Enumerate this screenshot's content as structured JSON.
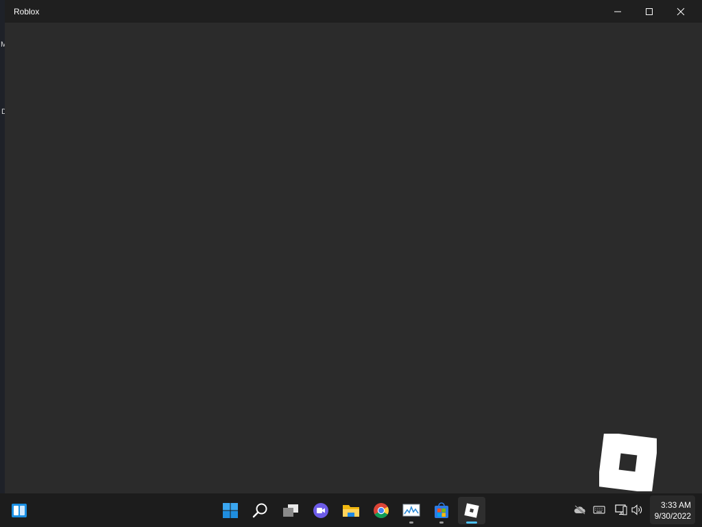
{
  "window": {
    "title": "Roblox",
    "controls": [
      "minimize-icon",
      "maximize-icon",
      "close-icon"
    ]
  },
  "desktop": {
    "fragment_1": "M",
    "fragment_2": "D"
  },
  "taskbar": {
    "pinned": [
      "widgets-icon",
      "start-icon",
      "search-icon",
      "task-view-icon",
      "chat-icon",
      "file-explorer-icon",
      "chrome-icon",
      "resource-monitor-icon",
      "store-icon",
      "roblox-icon"
    ],
    "tray": [
      "onedrive-icon",
      "keyboard-icon",
      "network-icon",
      "volume-icon"
    ],
    "time": "3:33 AM",
    "date": "9/30/2022"
  },
  "colors": {
    "window_bg": "#2b2b2b",
    "titlebar_bg": "#1f1f1f",
    "taskbar_bg": "#1c1c1c",
    "accent": "#4cc2ff"
  }
}
